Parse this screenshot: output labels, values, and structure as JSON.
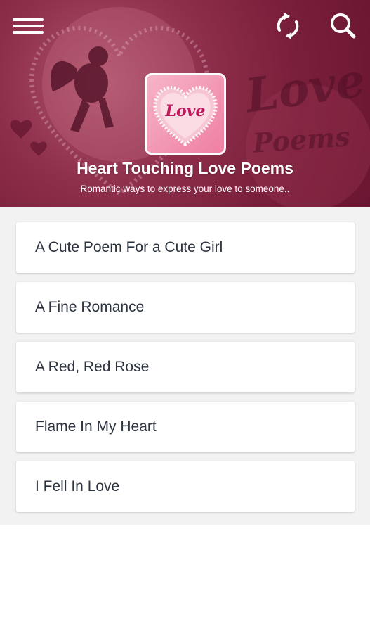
{
  "header": {
    "title": "Heart Touching Love Poems",
    "subtitle": "Romantic ways to express your love to someone..",
    "logo_text": "Love",
    "banner_word_1": "Love",
    "banner_word_2": "Poems",
    "menu_icon": "hamburger-menu-icon",
    "sync_icon": "sync-icon",
    "search_icon": "search-icon"
  },
  "poems": [
    {
      "title": "A Cute Poem For a Cute Girl"
    },
    {
      "title": "A Fine Romance"
    },
    {
      "title": "A Red, Red Rose"
    },
    {
      "title": "Flame In My Heart"
    },
    {
      "title": "I Fell In Love"
    }
  ],
  "colors": {
    "header_bg": "#7a1f3b",
    "list_bg": "#f2f2f2",
    "item_text": "#2c3440"
  }
}
